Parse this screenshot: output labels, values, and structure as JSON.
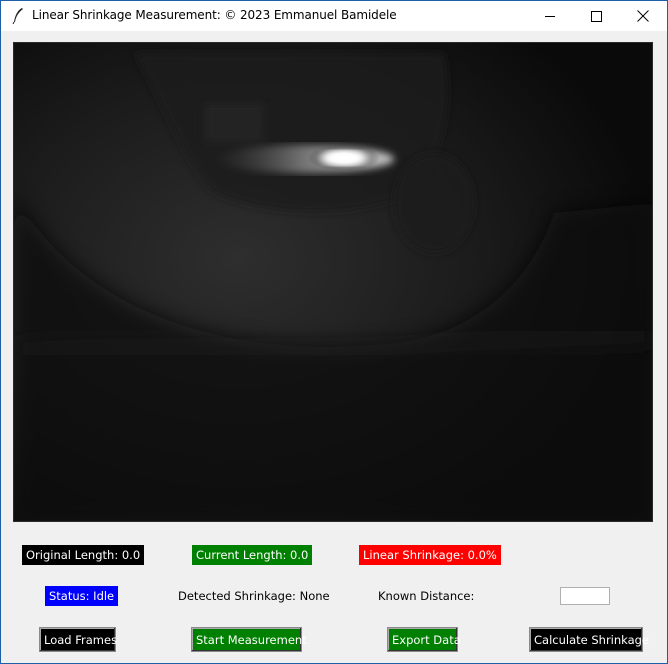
{
  "window": {
    "title": "Linear Shrinkage Measurement: © 2023 Emmanuel Bamidele",
    "controls": [
      "minimize-icon",
      "maximize-icon",
      "close-icon"
    ]
  },
  "labels": {
    "original_length": "Original Length: 0.0",
    "current_length": "Current Length: 0.0",
    "linear_shrinkage": "Linear Shrinkage: 0.0%",
    "status": "Status: Idle",
    "detected_shrinkage": "Detected Shrinkage: None",
    "known_distance": "Known Distance:"
  },
  "inputs": {
    "known_distance_value": ""
  },
  "buttons": {
    "load_frames": "Load Frames",
    "start_measurement": "Start Measurement",
    "export_data": "Export Data",
    "calculate_shrinkage": "Calculate Shrinkage"
  },
  "colors": {
    "label_black": "#000000",
    "label_green": "#008000",
    "label_red": "#ff0000",
    "label_blue": "#0000ff"
  }
}
